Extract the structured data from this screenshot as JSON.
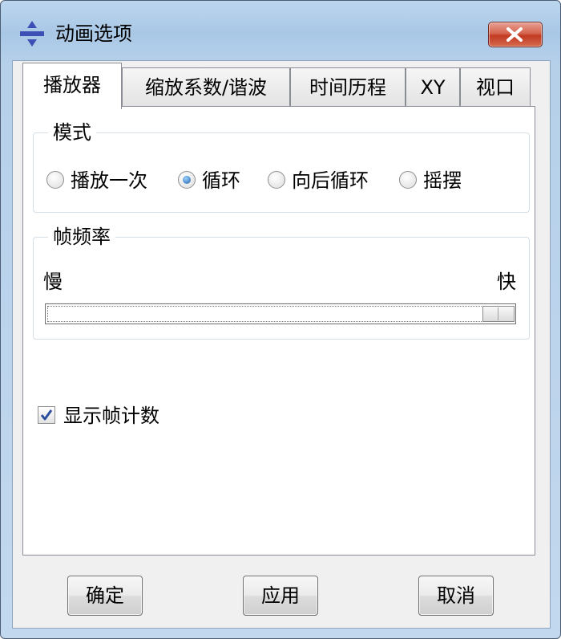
{
  "window": {
    "title": "动画选项",
    "close_icon": "close-icon",
    "app_icon": "animation-icon"
  },
  "tabs": [
    {
      "label": "播放器",
      "active": true
    },
    {
      "label": "缩放系数/谐波",
      "active": false
    },
    {
      "label": "时间历程",
      "active": false
    },
    {
      "label": "XY",
      "active": false
    },
    {
      "label": "视口",
      "active": false
    }
  ],
  "mode_group": {
    "title": "模式",
    "options": [
      {
        "label": "播放一次",
        "checked": false
      },
      {
        "label": "循环",
        "checked": true
      },
      {
        "label": "向后循环",
        "checked": false
      },
      {
        "label": "摇摆",
        "checked": false
      }
    ]
  },
  "frame_rate_group": {
    "title": "帧频率",
    "min_label": "慢",
    "max_label": "快",
    "value_fraction": 0.97
  },
  "show_frame_counter": {
    "label": "显示帧计数",
    "checked": true
  },
  "buttons": {
    "ok": "确定",
    "apply": "应用",
    "cancel": "取消"
  },
  "colors": {
    "close_button": "#c94a32",
    "radio_selected": "#1f5fa8",
    "checkmark": "#2b4f9c"
  }
}
